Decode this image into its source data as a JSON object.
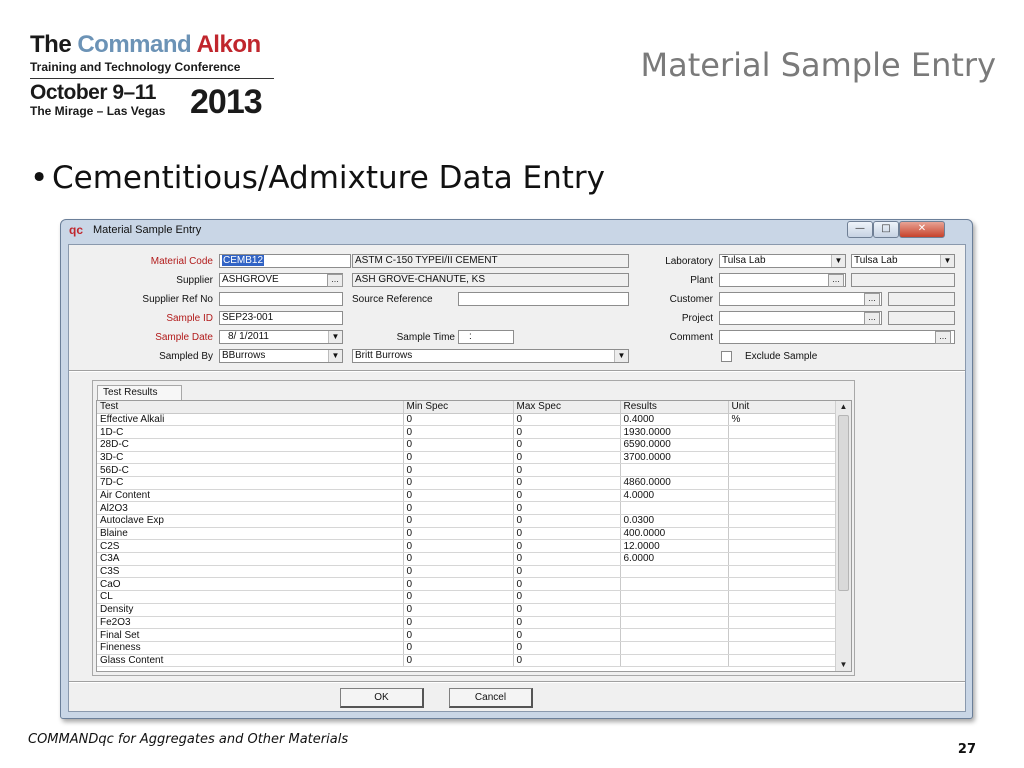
{
  "slide": {
    "logo": {
      "line1_the": "The",
      "line1_command": "Command",
      "line1_alkon": "Alkon",
      "line2": "Training and Technology Conference",
      "dates": "October 9–11",
      "venue": "The Mirage – Las Vegas",
      "year": "2013"
    },
    "title": "Material Sample Entry",
    "bullet": "Cementitious/Admixture Data Entry",
    "footer": "COMMANDqc for Aggregates and Other Materials",
    "page_number": "27"
  },
  "window": {
    "icon_text": "qc",
    "title": "Material Sample Entry",
    "controls": {
      "minimize": "—",
      "maximize": "□",
      "close": "✕"
    },
    "form": {
      "material_code": {
        "label": "Material Code",
        "value": "CEMB12",
        "description": "ASTM C-150 TYPEI/II CEMENT"
      },
      "supplier": {
        "label": "Supplier",
        "value": "ASHGROVE",
        "description": "ASH GROVE-CHANUTE, KS"
      },
      "supplier_ref": {
        "label": "Supplier Ref No",
        "value": ""
      },
      "source_reference": {
        "label": "Source Reference",
        "value": ""
      },
      "sample_id": {
        "label": "Sample ID",
        "value": "SEP23-001"
      },
      "sample_date": {
        "label": "Sample Date",
        "value": "8/ 1/2011"
      },
      "sample_time": {
        "label": "Sample Time",
        "value": ":"
      },
      "sampled_by": {
        "label": "Sampled By",
        "value": "BBurrows",
        "description": "Britt Burrows"
      },
      "laboratory": {
        "label": "Laboratory",
        "value": "Tulsa Lab",
        "value2": "Tulsa Lab"
      },
      "plant": {
        "label": "Plant",
        "value": ""
      },
      "customer": {
        "label": "Customer",
        "value": ""
      },
      "project": {
        "label": "Project",
        "value": ""
      },
      "comment": {
        "label": "Comment",
        "value": ""
      },
      "exclude_sample": {
        "label": "Exclude Sample",
        "checked": false
      },
      "ellipsis": "...",
      "dropdown_arrow": "▼"
    },
    "test_results": {
      "tab_label": "Test Results",
      "columns": [
        "Test",
        "Min Spec",
        "Max Spec",
        "Results",
        "Unit"
      ],
      "rows": [
        [
          "Effective Alkali",
          "0",
          "0",
          "0.4000",
          "%"
        ],
        [
          "1D-C",
          "0",
          "0",
          "1930.0000",
          ""
        ],
        [
          "28D-C",
          "0",
          "0",
          "6590.0000",
          ""
        ],
        [
          "3D-C",
          "0",
          "0",
          "3700.0000",
          ""
        ],
        [
          "56D-C",
          "0",
          "0",
          "",
          ""
        ],
        [
          "7D-C",
          "0",
          "0",
          "4860.0000",
          ""
        ],
        [
          "Air Content",
          "0",
          "0",
          "4.0000",
          ""
        ],
        [
          "Al2O3",
          "0",
          "0",
          "",
          ""
        ],
        [
          "Autoclave Exp",
          "0",
          "0",
          "0.0300",
          ""
        ],
        [
          "Blaine",
          "0",
          "0",
          "400.0000",
          ""
        ],
        [
          "C2S",
          "0",
          "0",
          "12.0000",
          ""
        ],
        [
          "C3A",
          "0",
          "0",
          "6.0000",
          ""
        ],
        [
          "C3S",
          "0",
          "0",
          "",
          ""
        ],
        [
          "CaO",
          "0",
          "0",
          "",
          ""
        ],
        [
          "CL",
          "0",
          "0",
          "",
          ""
        ],
        [
          "Density",
          "0",
          "0",
          "",
          ""
        ],
        [
          "Fe2O3",
          "0",
          "0",
          "",
          ""
        ],
        [
          "Final Set",
          "0",
          "0",
          "",
          ""
        ],
        [
          "Fineness",
          "0",
          "0",
          "",
          ""
        ],
        [
          "Glass Content",
          "0",
          "0",
          "",
          ""
        ]
      ]
    },
    "buttons": {
      "ok": "OK",
      "cancel": "Cancel"
    },
    "scroll": {
      "up": "▲",
      "down": "▼"
    }
  }
}
